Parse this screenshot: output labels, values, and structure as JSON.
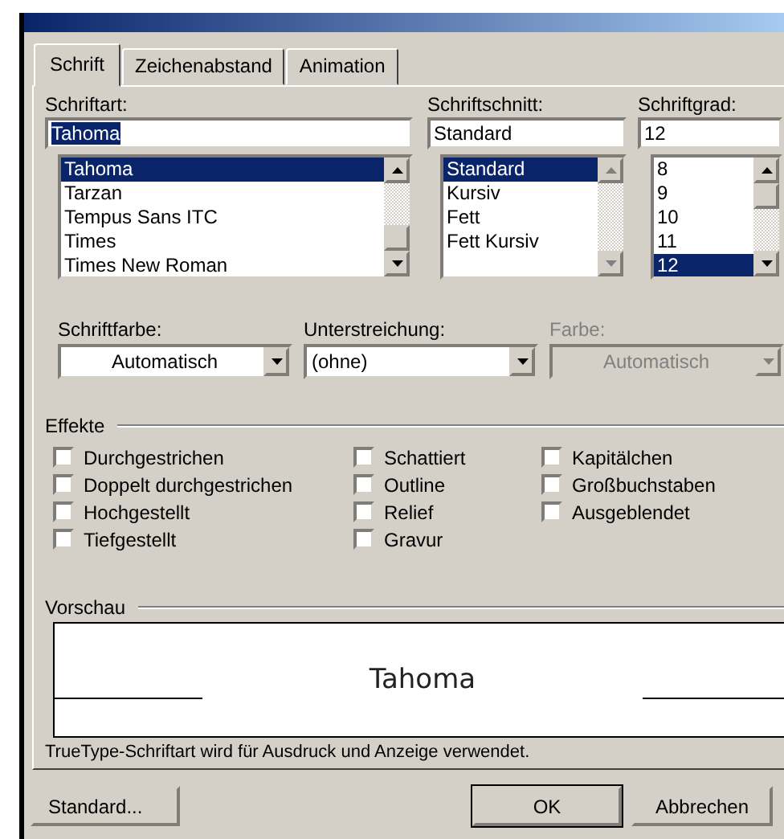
{
  "tabs": [
    {
      "label": "Schrift",
      "selected": true
    },
    {
      "label": "Zeichenabstand",
      "selected": false
    },
    {
      "label": "Animation",
      "selected": false
    }
  ],
  "lists": [
    {
      "label": "Schriftart:",
      "value": "Tahoma",
      "value_selected": true,
      "scroll_enabled": true,
      "items": [
        {
          "label": "Tahoma",
          "selected": true
        },
        {
          "label": "Tarzan",
          "selected": false
        },
        {
          "label": "Tempus Sans ITC",
          "selected": false
        },
        {
          "label": "Times",
          "selected": false
        },
        {
          "label": "Times New Roman",
          "selected": false
        }
      ]
    },
    {
      "label": "Schriftschnitt:",
      "value": "Standard",
      "value_selected": false,
      "scroll_enabled": false,
      "items": [
        {
          "label": "Standard",
          "selected": true
        },
        {
          "label": "Kursiv",
          "selected": false
        },
        {
          "label": "Fett",
          "selected": false
        },
        {
          "label": "Fett Kursiv",
          "selected": false
        }
      ]
    },
    {
      "label": "Schriftgrad:",
      "value": "12",
      "value_selected": false,
      "scroll_enabled": true,
      "items": [
        {
          "label": "8",
          "selected": false
        },
        {
          "label": "9",
          "selected": false
        },
        {
          "label": "10",
          "selected": false
        },
        {
          "label": "11",
          "selected": false
        },
        {
          "label": "12",
          "selected": true
        }
      ]
    }
  ],
  "dropdowns": [
    {
      "label": "Schriftfarbe:",
      "value": "Automatisch",
      "centered": true,
      "disabled": false
    },
    {
      "label": "Unterstreichung:",
      "value": "(ohne)",
      "centered": false,
      "disabled": false
    },
    {
      "label": "Farbe:",
      "value": "Automatisch",
      "centered": true,
      "disabled": true
    }
  ],
  "effects": {
    "title": "Effekte",
    "columns": [
      [
        {
          "label": "Durchgestrichen",
          "checked": false
        },
        {
          "label": "Doppelt durchgestrichen",
          "checked": false
        },
        {
          "label": "Hochgestellt",
          "checked": false
        },
        {
          "label": "Tiefgestellt",
          "checked": false
        }
      ],
      [
        {
          "label": "Schattiert",
          "checked": false
        },
        {
          "label": "Outline",
          "checked": false
        },
        {
          "label": "Relief",
          "checked": false
        },
        {
          "label": "Gravur",
          "checked": false
        }
      ],
      [
        {
          "label": "Kapitälchen",
          "checked": false
        },
        {
          "label": "Großbuchstaben",
          "checked": false
        },
        {
          "label": "Ausgeblendet",
          "checked": false
        }
      ]
    ]
  },
  "preview": {
    "title": "Vorschau",
    "text": "Tahoma"
  },
  "note": "TrueType-Schriftart wird für Ausdruck und Anzeige verwendet.",
  "buttons": [
    {
      "label": "Standard...",
      "default": false
    },
    {
      "label": "OK",
      "default": true
    },
    {
      "label": "Abbrechen",
      "default": false
    }
  ]
}
